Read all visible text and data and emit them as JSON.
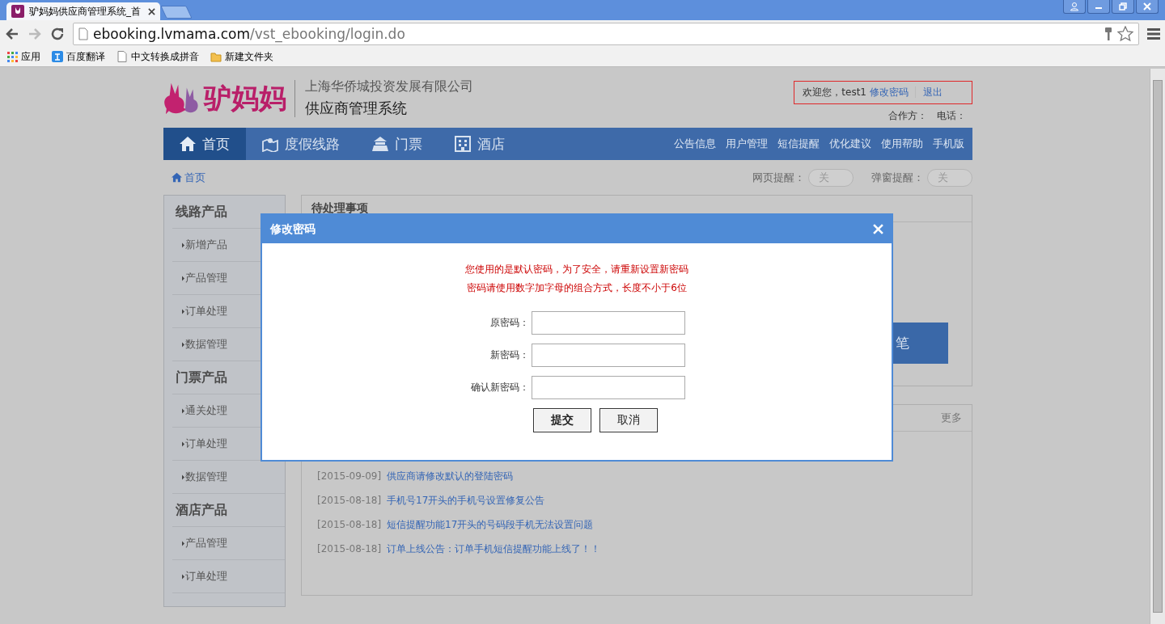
{
  "browser": {
    "tab_title": "驴妈妈供应商管理系统_首",
    "url_host": "ebooking.lvmama.com",
    "url_path": "/vst_ebooking/login.do",
    "bookmarks": [
      {
        "label": "应用",
        "kind": "apps"
      },
      {
        "label": "百度翻译",
        "kind": "translate"
      },
      {
        "label": "中文转换成拼音",
        "kind": "page"
      },
      {
        "label": "新建文件夹",
        "kind": "folder"
      }
    ]
  },
  "header": {
    "logo_text": "驴妈妈",
    "company": "上海华侨城投资发展有限公司",
    "system": "供应商管理系统",
    "welcome": "欢迎您，test1",
    "change_password": "修改密码",
    "logout": "退出",
    "partner": "合作方：",
    "phone": "电话："
  },
  "nav": {
    "items": [
      {
        "label": "首页",
        "kind": "home",
        "selected": true
      },
      {
        "label": "度假线路",
        "kind": "map",
        "selected": false
      },
      {
        "label": "门票",
        "kind": "temple",
        "selected": false
      },
      {
        "label": "酒店",
        "kind": "building",
        "selected": false
      }
    ],
    "links": [
      "公告信息",
      "用户管理",
      "短信提醒",
      "优化建议",
      "使用帮助",
      "手机版"
    ]
  },
  "breadcrumb": "首页",
  "toggles": [
    {
      "label": "网页提醒：",
      "state_text": "关",
      "on": false
    },
    {
      "label": "弹窗提醒：",
      "state_text": "关",
      "on": false
    }
  ],
  "sidebar": {
    "groups": [
      {
        "title": "线路产品",
        "items": [
          "新增产品",
          "产品管理",
          "订单处理",
          "数据管理"
        ]
      },
      {
        "title": "门票产品",
        "items": [
          "通关处理",
          "订单处理",
          "数据管理"
        ]
      },
      {
        "title": "酒店产品",
        "items": [
          "产品管理",
          "订单处理"
        ]
      }
    ]
  },
  "pending": {
    "title": "待处理事项",
    "unit": "笔"
  },
  "notices": {
    "more": "更多",
    "items": [
      {
        "date": "[2015-09-09]",
        "title": "供应商请修改默认的登陆密码"
      },
      {
        "date": "[2015-08-18]",
        "title": "手机号17开头的手机号设置修复公告"
      },
      {
        "date": "[2015-08-18]",
        "title": "短信提醒功能17开头的号码段手机无法设置问题"
      },
      {
        "date": "[2015-08-18]",
        "title": "订单上线公告：订单手机短信提醒功能上线了！！"
      }
    ]
  },
  "dialog": {
    "title": "修改密码",
    "messages": [
      "您使用的是默认密码，为了安全，请重新设置新密码",
      "密码请使用数字加字母的组合方式，长度不小于6位"
    ],
    "fields": [
      {
        "label": "原密码："
      },
      {
        "label": "新密码："
      },
      {
        "label": "确认新密码："
      }
    ],
    "buttons": [
      "提交",
      "取消"
    ]
  }
}
